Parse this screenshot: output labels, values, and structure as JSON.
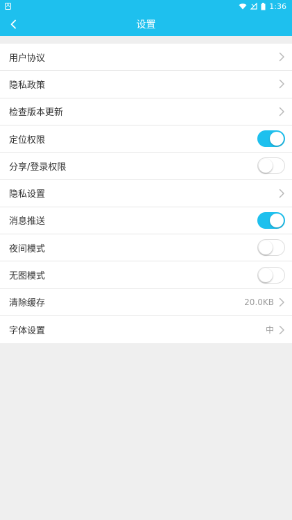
{
  "status_bar": {
    "notification_icon": "notification-box-icon",
    "time": "1:36"
  },
  "app_bar": {
    "title": "设置",
    "back_icon": "back-chevron-icon"
  },
  "colors": {
    "accent": "#1ec0ee",
    "background": "#efefef",
    "text": "#333333",
    "muted": "#9a9a9a"
  },
  "settings": [
    {
      "label": "用户协议",
      "type": "link"
    },
    {
      "label": "隐私政策",
      "type": "link"
    },
    {
      "label": "检查版本更新",
      "type": "link"
    },
    {
      "label": "定位权限",
      "type": "toggle",
      "on": true
    },
    {
      "label": "分享/登录权限",
      "type": "toggle",
      "on": false
    },
    {
      "label": "隐私设置",
      "type": "link"
    },
    {
      "label": "消息推送",
      "type": "toggle",
      "on": true
    },
    {
      "label": "夜间模式",
      "type": "toggle",
      "on": false
    },
    {
      "label": "无图模式",
      "type": "toggle",
      "on": false
    },
    {
      "label": "清除缓存",
      "type": "link",
      "value": "20.0KB"
    },
    {
      "label": "字体设置",
      "type": "link",
      "value": "中"
    }
  ]
}
